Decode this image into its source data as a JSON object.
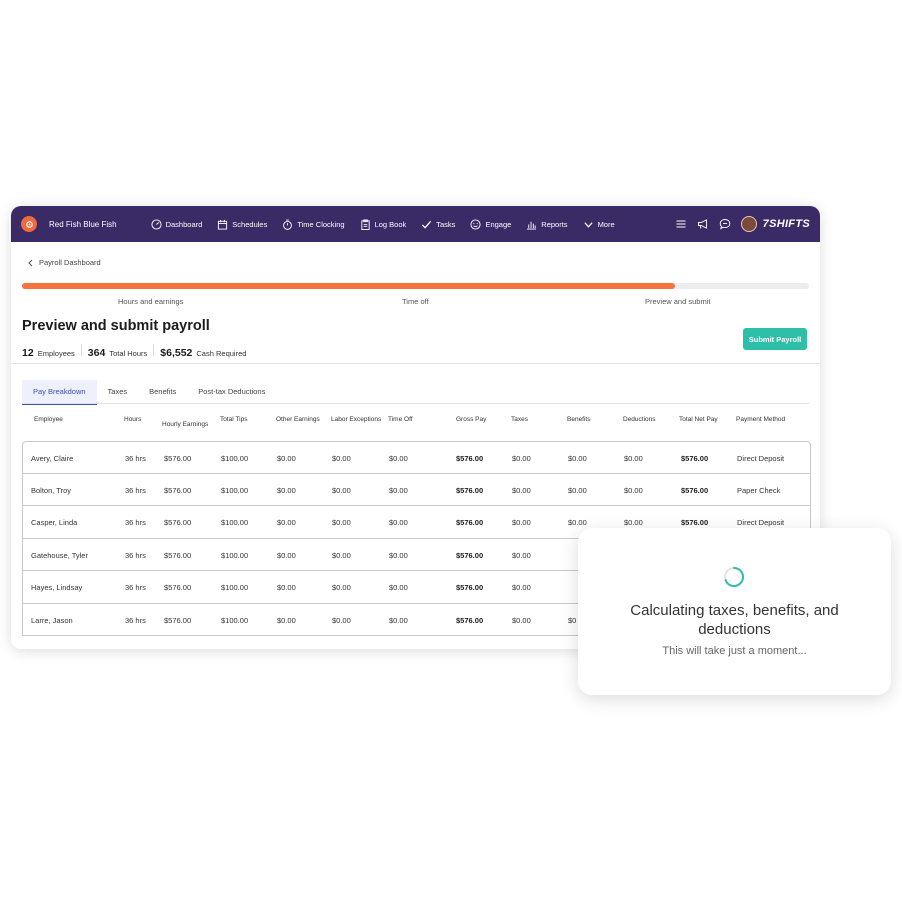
{
  "topbar": {
    "brand": "Red Fish Blue Fish",
    "nav": [
      {
        "label": "Dashboard",
        "icon": "gauge-icon"
      },
      {
        "label": "Schedules",
        "icon": "calendar-icon"
      },
      {
        "label": "Time Clocking",
        "icon": "stopwatch-icon"
      },
      {
        "label": "Log Book",
        "icon": "clipboard-icon"
      },
      {
        "label": "Tasks",
        "icon": "check-icon"
      },
      {
        "label": "Engage",
        "icon": "smile-icon"
      },
      {
        "label": "Reports",
        "icon": "bar-chart-icon"
      },
      {
        "label": "More",
        "icon": "chevron-down-icon"
      }
    ],
    "logo": "7SHIFTS",
    "colors": {
      "bar": "#3a2a66",
      "brand_circle": "#f06a3d"
    }
  },
  "breadcrumb": "Payroll Dashboard",
  "progress": {
    "fraction": 0.83,
    "steps": [
      "Hours and earnings",
      "Time off",
      "Preview and submit"
    ],
    "color": "#f4733e"
  },
  "page": {
    "title": "Preview and submit payroll",
    "stats": [
      {
        "value": "12",
        "label": "Employees"
      },
      {
        "value": "364",
        "label": "Total Hours"
      },
      {
        "value": "$6,552",
        "label": "Cash Required"
      }
    ],
    "submit_label": "Submit Payroll",
    "submit_color": "#2dbfa8"
  },
  "tabs": [
    "Pay Breakdown",
    "Taxes",
    "Benefits",
    "Post-tax Deductions"
  ],
  "table": {
    "headers": [
      "Employee",
      "Hours",
      "Hourly Earnings",
      "Total Tips",
      "Other Earnings",
      "Labor Exceptions",
      "Time Off",
      "Gross Pay",
      "Taxes",
      "Benefits",
      "Deductions",
      "Total Net Pay",
      "Payment Method"
    ],
    "rows": [
      [
        "Avery, Claire",
        "36 hrs",
        "$576.00",
        "$100.00",
        "$0.00",
        "$0.00",
        "$0.00",
        "$576.00",
        "$0.00",
        "$0.00",
        "$0.00",
        "$576.00",
        "Direct Deposit"
      ],
      [
        "Bolton, Troy",
        "36 hrs",
        "$576.00",
        "$100.00",
        "$0.00",
        "$0.00",
        "$0.00",
        "$576.00",
        "$0.00",
        "$0.00",
        "$0.00",
        "$576.00",
        "Paper Check"
      ],
      [
        "Casper, Linda",
        "36 hrs",
        "$576.00",
        "$100.00",
        "$0.00",
        "$0.00",
        "$0.00",
        "$576.00",
        "$0.00",
        "$0.00",
        "$0.00",
        "$576.00",
        "Direct Deposit"
      ],
      [
        "Gatehouse, Tyler",
        "36 hrs",
        "$576.00",
        "$100.00",
        "$0.00",
        "$0.00",
        "$0.00",
        "$576.00",
        "$0.00",
        "",
        "",
        "",
        ""
      ],
      [
        "Hayes, Lindsay",
        "36 hrs",
        "$576.00",
        "$100.00",
        "$0.00",
        "$0.00",
        "$0.00",
        "$576.00",
        "$0.00",
        "",
        "",
        "",
        ""
      ],
      [
        "Larre, Jason",
        "36 hrs",
        "$576.00",
        "$100.00",
        "$0.00",
        "$0.00",
        "$0.00",
        "$576.00",
        "$0.00",
        "$0",
        "",
        "",
        ""
      ]
    ]
  },
  "overlay": {
    "title": "Calculating taxes, benefits, and deductions",
    "subtitle": "This will take just a moment...",
    "spinner_color": "#2dbfa8"
  }
}
